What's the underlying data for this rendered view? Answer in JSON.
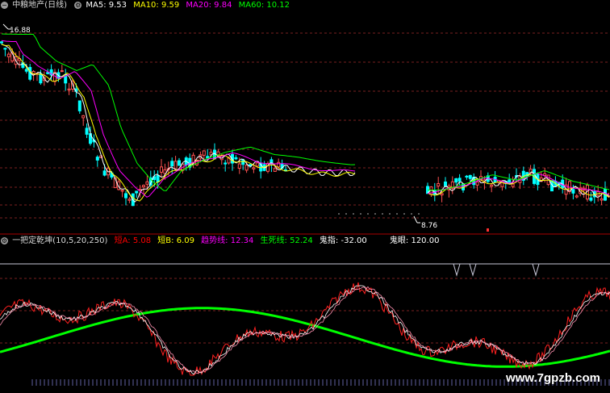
{
  "header": {
    "stock_name": "中粮地产(日线)",
    "ma_items": [
      {
        "label": "MA5: 9.53",
        "color": "#ffffff"
      },
      {
        "label": "MA10: 9.59",
        "color": "#ffff00"
      },
      {
        "label": "MA20: 9.84",
        "color": "#ff00ff"
      },
      {
        "label": "MA60: 10.12",
        "color": "#00ff00"
      }
    ]
  },
  "indicator": {
    "name": "一把定乾坤(10,5,20,250)",
    "items": [
      {
        "label": "短A: 5.08",
        "color": "#ff0000"
      },
      {
        "label": "短B: 6.09",
        "color": "#ffff00"
      },
      {
        "label": "趋势线: 12.34",
        "color": "#ff00ff"
      },
      {
        "label": "生死线: 52.24",
        "color": "#00ff00"
      },
      {
        "label": "鬼指: -32.00",
        "color": "#ffffff"
      },
      {
        "label": "鬼眼: 120.00",
        "color": "#ffffff"
      }
    ]
  },
  "price_labels": {
    "high": "16.88",
    "low": "8.76"
  },
  "watermark": "www.7gpzb.com",
  "colors": {
    "background": "#000000",
    "grid": "#7a1f1f",
    "separator": "#aa0000",
    "up_candle": "#ff5050",
    "down_candle": "#00ffff",
    "ma5": "#ffffff",
    "ma10": "#ffff00",
    "ma20": "#ff00ff",
    "ma60": "#00ff00"
  }
}
